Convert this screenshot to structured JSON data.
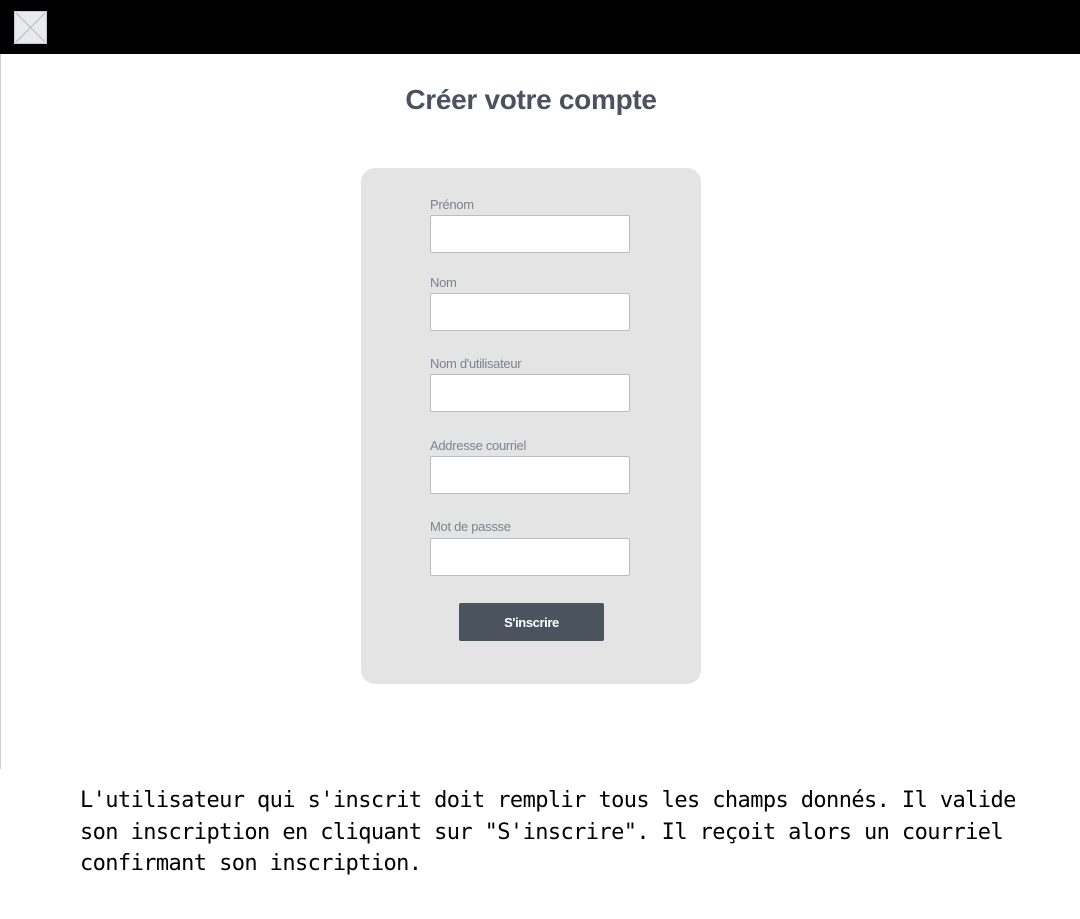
{
  "header": {
    "logo_icon": "image-placeholder-icon",
    "background": "#000000"
  },
  "page": {
    "title": "Créer votre compte"
  },
  "form": {
    "fields": [
      {
        "label": "Prénom",
        "value": "",
        "placeholder": ""
      },
      {
        "label": "Nom",
        "value": "",
        "placeholder": ""
      },
      {
        "label": "Nom d'utilisateur",
        "value": "",
        "placeholder": ""
      },
      {
        "label": "Addresse courriel",
        "value": "",
        "placeholder": ""
      },
      {
        "label": "Mot de passse",
        "value": "",
        "placeholder": ""
      }
    ],
    "submit_label": "S'inscrire",
    "card_color": "#e4e4e4",
    "button_color": "#4a535e"
  },
  "caption": {
    "text": "L'utilisateur qui s'inscrit doit remplir tous les champs donnés. Il valide son inscription en cliquant sur \"S'inscrire\". Il reçoit alors un courriel confirmant son inscription."
  }
}
